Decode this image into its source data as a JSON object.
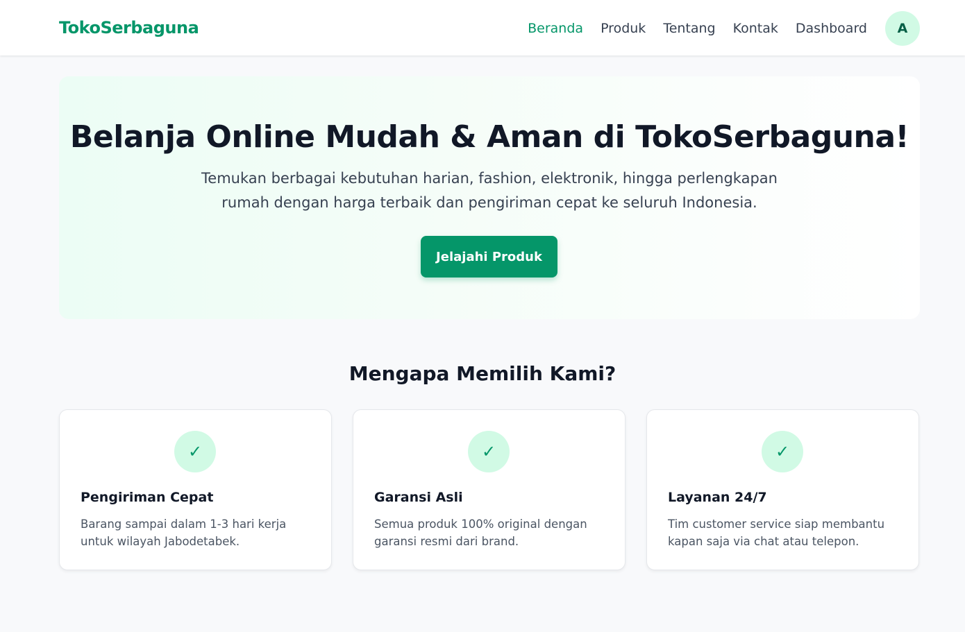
{
  "navbar": {
    "brand": "TokoSerbaguna",
    "links": [
      {
        "label": "Beranda",
        "active": true
      },
      {
        "label": "Produk",
        "active": false
      },
      {
        "label": "Tentang",
        "active": false
      },
      {
        "label": "Kontak",
        "active": false
      },
      {
        "label": "Dashboard",
        "active": false
      }
    ],
    "avatar_initial": "A"
  },
  "hero": {
    "title": "Belanja Online Mudah & Aman di TokoSerbaguna!",
    "subtitle": "Temukan berbagai kebutuhan harian, fashion, elektronik, hingga perlengkapan rumah dengan harga terbaik dan pengiriman cepat ke seluruh Indonesia.",
    "cta_label": "Jelajahi Produk"
  },
  "features": {
    "title": "Mengapa Memilih Kami?",
    "items": [
      {
        "icon": "check-icon",
        "glyph": "✓",
        "title": "Pengiriman Cepat",
        "description": "Barang sampai dalam 1-3 hari kerja untuk wilayah Jabodetabek."
      },
      {
        "icon": "check-icon",
        "glyph": "✓",
        "title": "Garansi Asli",
        "description": "Semua produk 100% original dengan garansi resmi dari brand."
      },
      {
        "icon": "check-icon",
        "glyph": "✓",
        "title": "Layanan 24/7",
        "description": "Tim customer service siap membantu kapan saja via chat atau telepon."
      }
    ]
  },
  "colors": {
    "brand": "#059669",
    "accent_light": "#d1fae5",
    "text_dark": "#111827",
    "text_muted": "#4b5563",
    "background": "#f8f9fb"
  }
}
